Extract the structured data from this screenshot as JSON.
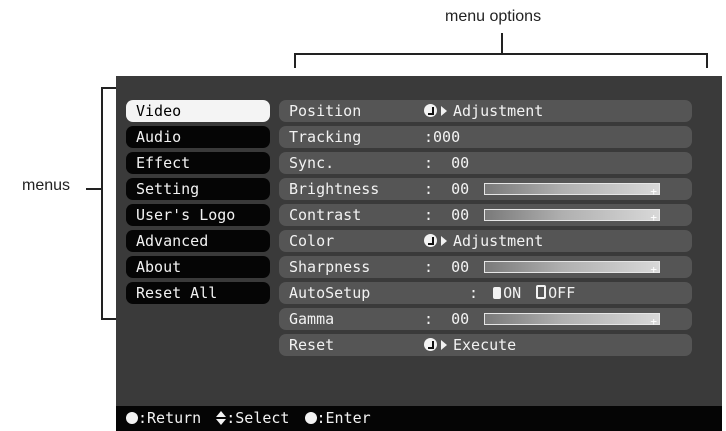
{
  "annotations": {
    "menu_options_label": "menu options",
    "menus_label": "menus"
  },
  "menus": [
    {
      "label": "Video",
      "selected": true
    },
    {
      "label": "Audio",
      "selected": false
    },
    {
      "label": "Effect",
      "selected": false
    },
    {
      "label": "Setting",
      "selected": false
    },
    {
      "label": "User's Logo",
      "selected": false
    },
    {
      "label": "Advanced",
      "selected": false
    },
    {
      "label": "About",
      "selected": false
    },
    {
      "label": "Reset All",
      "selected": false
    }
  ],
  "options": [
    {
      "label": "Position",
      "icon": "enter-icon",
      "value": "Adjustment"
    },
    {
      "label": "Tracking",
      "value": ":000"
    },
    {
      "label": "Sync.",
      "value": ":  00"
    },
    {
      "label": "Brightness",
      "value": ":  00",
      "slider": true
    },
    {
      "label": "Contrast",
      "value": ":  00",
      "slider": true
    },
    {
      "label": "Color",
      "icon": "enter-icon",
      "value": "Adjustment"
    },
    {
      "label": "Sharpness",
      "value": ":  00",
      "slider": true
    },
    {
      "label": "AutoSetup",
      "value": ":",
      "on": "ON",
      "off": "OFF"
    },
    {
      "label": "Gamma",
      "value": ":  00",
      "slider": true
    },
    {
      "label": "Reset",
      "icon": "enter-icon",
      "value": "Execute"
    }
  ],
  "bottom_bar": {
    "return_text": ":Return",
    "select_text": ":Select",
    "enter_text": ":Enter"
  },
  "colors": {
    "screen_bg": "#3a3a3a",
    "menu_bg": "#050505",
    "option_bg": "#555555",
    "selected_bg": "#f4f4f4"
  }
}
